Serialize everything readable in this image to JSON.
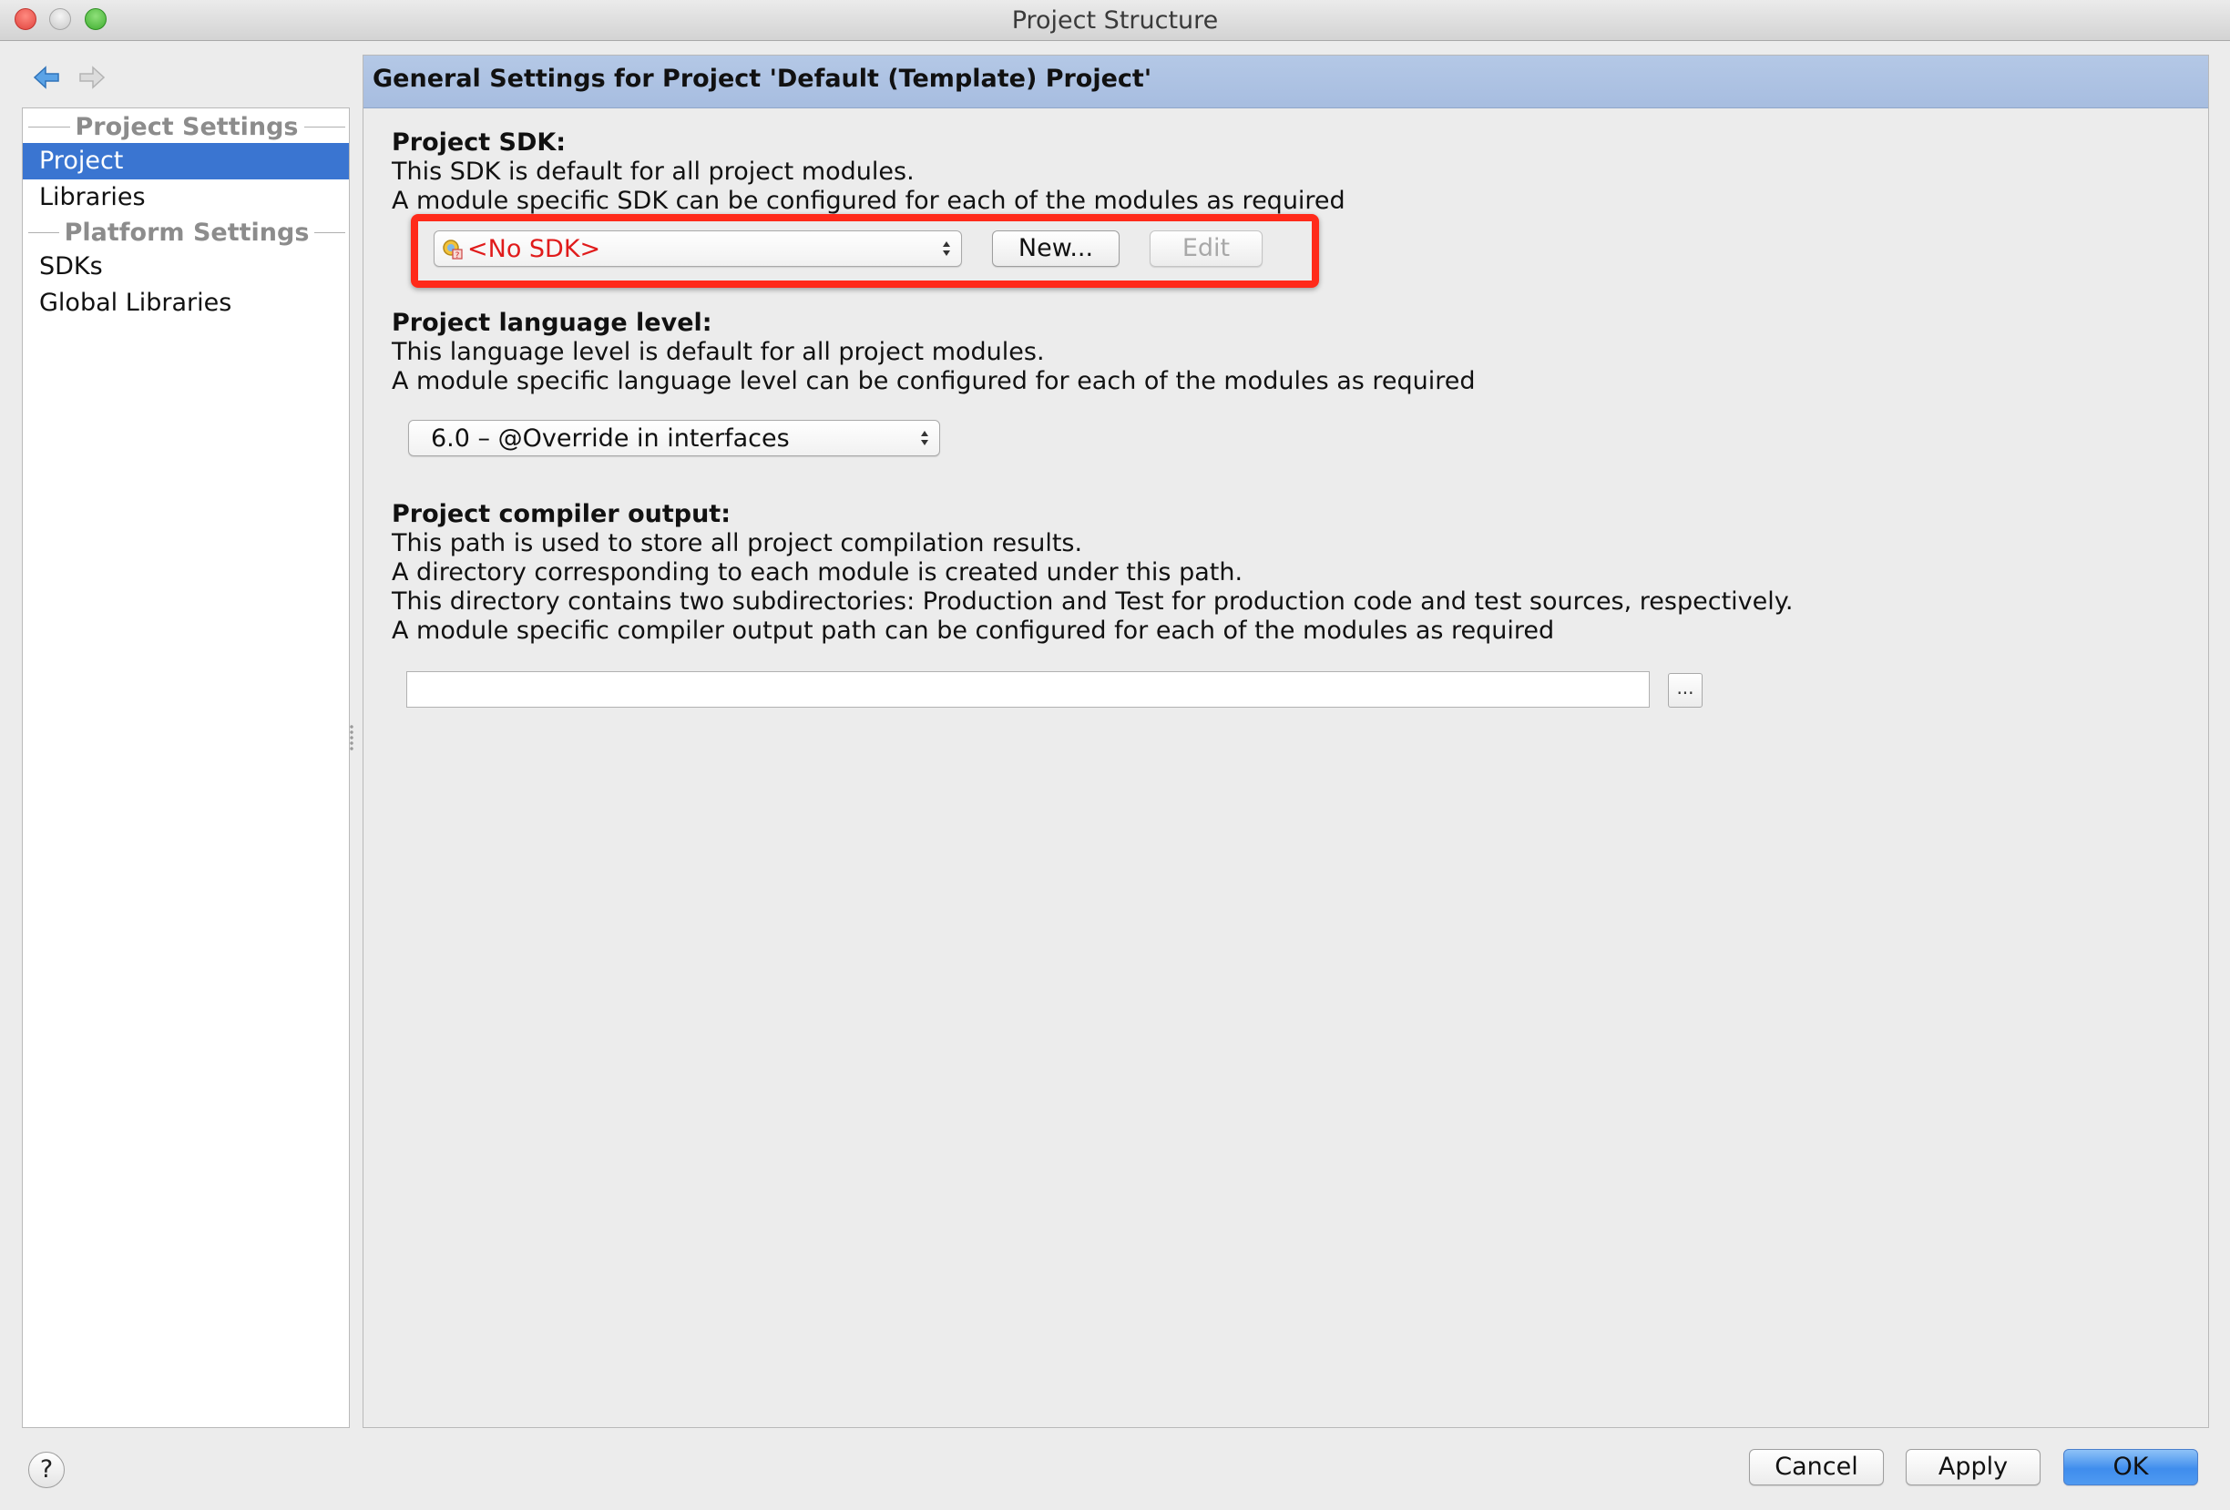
{
  "window": {
    "title": "Project Structure"
  },
  "nav": {
    "back_icon": "arrow-left-icon",
    "forward_icon": "arrow-right-icon"
  },
  "sidebar": {
    "project_settings_header": "Project Settings",
    "platform_settings_header": "Platform Settings",
    "items": [
      {
        "label": "Project",
        "selected": true
      },
      {
        "label": "Libraries",
        "selected": false
      },
      {
        "label": "SDKs",
        "selected": false
      },
      {
        "label": "Global Libraries",
        "selected": false
      }
    ]
  },
  "content": {
    "header": "General Settings for Project 'Default (Template) Project'",
    "sdk": {
      "title": "Project SDK:",
      "line1": "This SDK is default for all project modules.",
      "line2": "A module specific SDK can be configured for each of the modules as required",
      "selected_value": "<No SDK>",
      "new_button": "New...",
      "edit_button": "Edit"
    },
    "language": {
      "title": "Project language level:",
      "line1": "This language level is default for all project modules.",
      "line2": "A module specific language level can be configured for each of the modules as required",
      "selected_value": "6.0 – @Override in interfaces"
    },
    "compiler": {
      "title": "Project compiler output:",
      "line1": "This path is used to store all project compilation results.",
      "line2": "A directory corresponding to each module is created under this path.",
      "line3": "This directory contains two subdirectories: Production and Test for production code and test sources, respectively.",
      "line4": "A module specific compiler output path can be configured for each of the modules as required",
      "path_value": "",
      "browse_button": "..."
    }
  },
  "footer": {
    "help_button": "?",
    "cancel_button": "Cancel",
    "apply_button": "Apply",
    "ok_button": "OK"
  },
  "colors": {
    "selection": "#3a75d1",
    "header_band": "#a7bde0",
    "no_sdk_text": "#e01b1b",
    "highlight_box": "#ff2a1a",
    "default_button": "#4f9af1"
  }
}
